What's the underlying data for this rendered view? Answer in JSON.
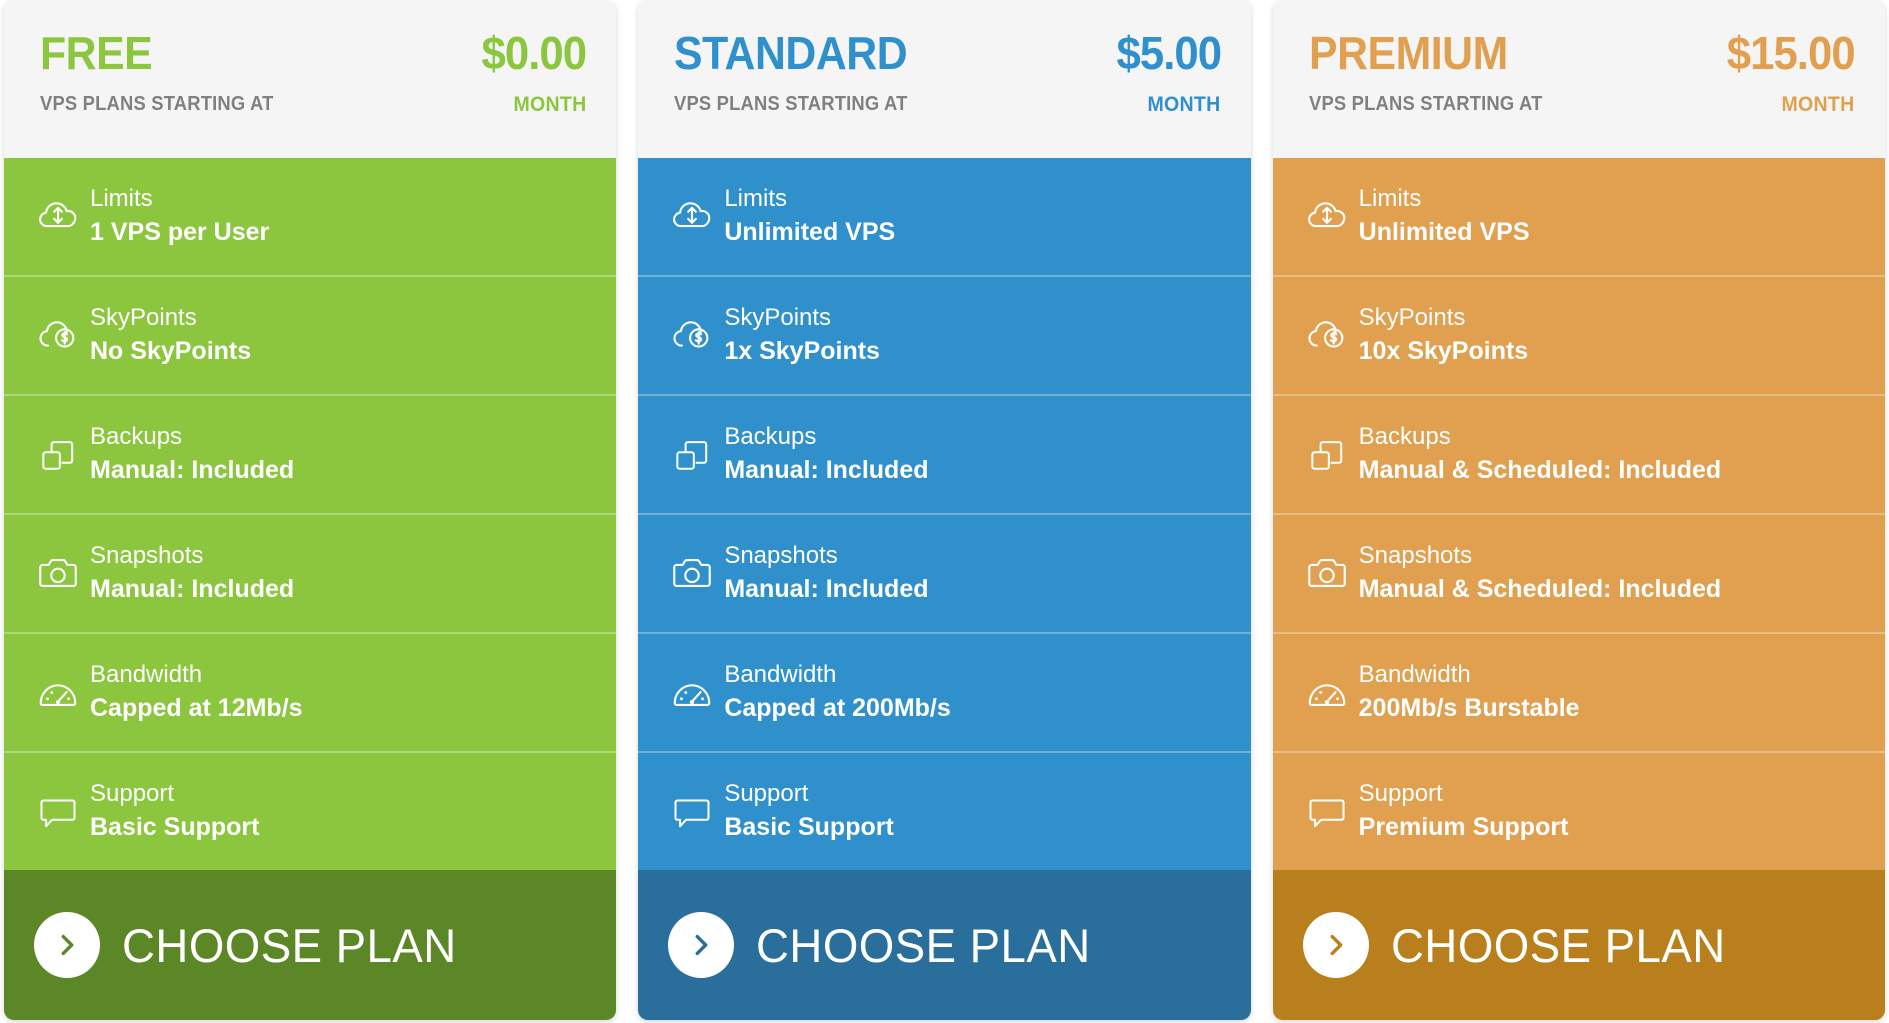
{
  "plans": [
    {
      "name": "FREE",
      "tagline": "VPS PLANS STARTING AT",
      "price": "$0.00",
      "period": "MONTH",
      "accent": "#8CC63E",
      "body_color": "#8CC63E",
      "cta_color": "#5C8727",
      "cta_label": "CHOOSE PLAN",
      "features": [
        {
          "icon": "cloud-upload-icon",
          "label": "Limits",
          "value": "1 VPS per User"
        },
        {
          "icon": "cloud-skypoints-icon",
          "label": "SkyPoints",
          "value": "No SkyPoints"
        },
        {
          "icon": "backups-icon",
          "label": "Backups",
          "value": "Manual: Included"
        },
        {
          "icon": "camera-icon",
          "label": "Snapshots",
          "value": "Manual: Included"
        },
        {
          "icon": "gauge-icon",
          "label": "Bandwidth",
          "value": "Capped at 12Mb/s"
        },
        {
          "icon": "chat-bubble-icon",
          "label": "Support",
          "value": "Basic Support"
        }
      ]
    },
    {
      "name": "STANDARD",
      "tagline": "VPS PLANS STARTING AT",
      "price": "$5.00",
      "period": "MONTH",
      "accent": "#2F90CC",
      "body_color": "#2F90CC",
      "cta_color": "#2A6E9B",
      "cta_label": "CHOOSE PLAN",
      "features": [
        {
          "icon": "cloud-upload-icon",
          "label": "Limits",
          "value": "Unlimited VPS"
        },
        {
          "icon": "cloud-skypoints-icon",
          "label": "SkyPoints",
          "value": "1x SkyPoints"
        },
        {
          "icon": "backups-icon",
          "label": "Backups",
          "value": "Manual: Included"
        },
        {
          "icon": "camera-icon",
          "label": "Snapshots",
          "value": "Manual: Included"
        },
        {
          "icon": "gauge-icon",
          "label": "Bandwidth",
          "value": "Capped at 200Mb/s"
        },
        {
          "icon": "chat-bubble-icon",
          "label": "Support",
          "value": "Basic Support"
        }
      ]
    },
    {
      "name": "PREMIUM",
      "tagline": "VPS PLANS STARTING AT",
      "price": "$15.00",
      "period": "MONTH",
      "accent": "#E0A04F",
      "body_color": "#E0A04F",
      "cta_color": "#B97F1C",
      "cta_label": "CHOOSE PLAN",
      "features": [
        {
          "icon": "cloud-upload-icon",
          "label": "Limits",
          "value": "Unlimited VPS"
        },
        {
          "icon": "cloud-skypoints-icon",
          "label": "SkyPoints",
          "value": "10x SkyPoints"
        },
        {
          "icon": "backups-icon",
          "label": "Backups",
          "value": "Manual & Scheduled: Included"
        },
        {
          "icon": "camera-icon",
          "label": "Snapshots",
          "value": "Manual & Scheduled: Included"
        },
        {
          "icon": "gauge-icon",
          "label": "Bandwidth",
          "value": "200Mb/s Burstable"
        },
        {
          "icon": "chat-bubble-icon",
          "label": "Support",
          "value": "Premium Support"
        }
      ]
    }
  ],
  "colors": {
    "header_bg": "#F5F5F5",
    "tagline_text": "#808080",
    "feature_text": "#FFFFFF"
  }
}
